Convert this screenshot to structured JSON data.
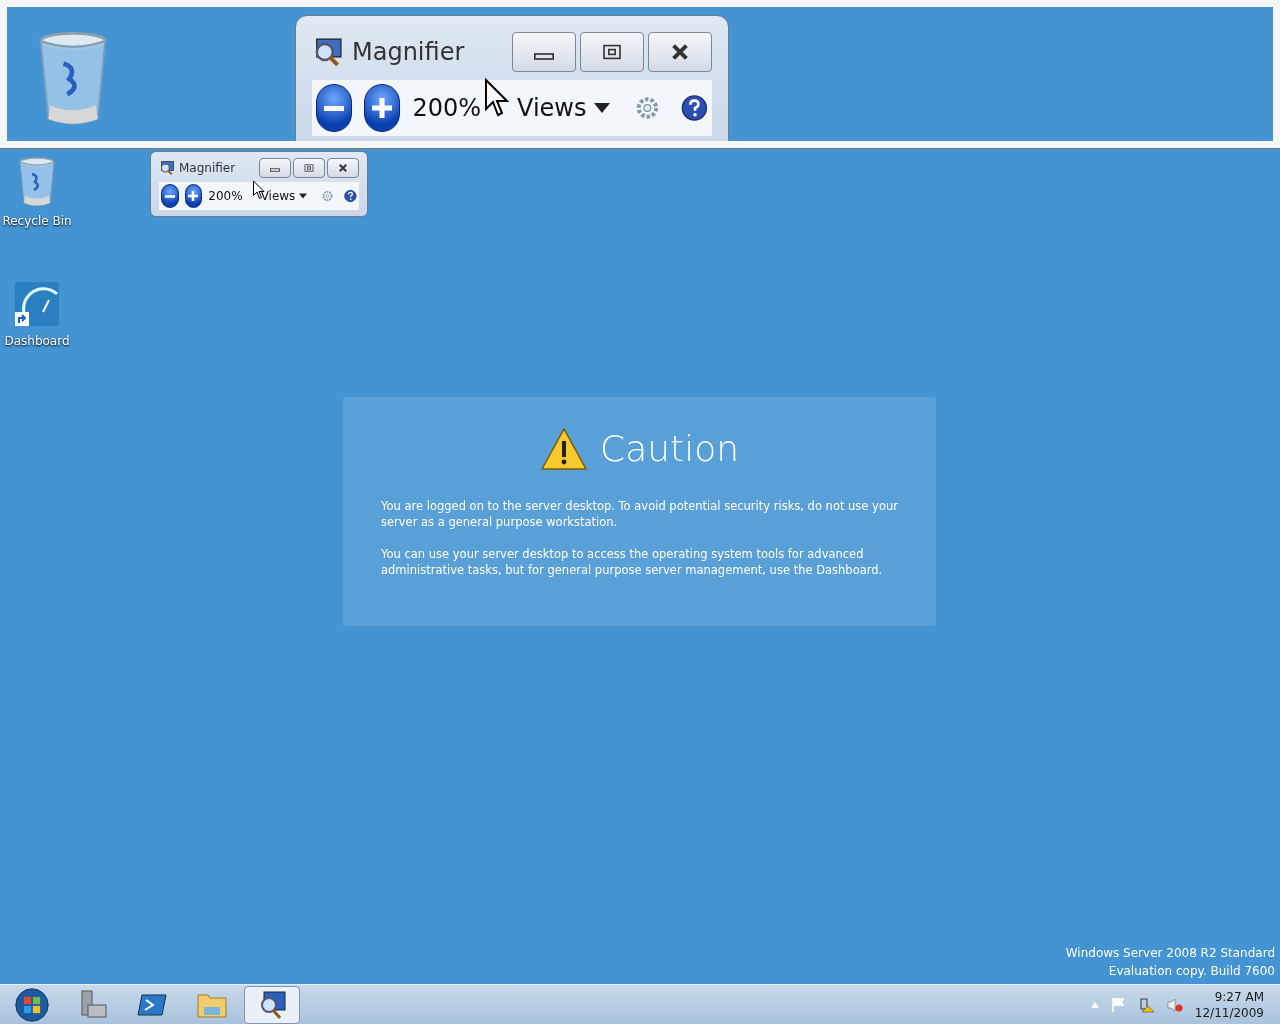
{
  "magnifier_view": {
    "title": "Magnifier",
    "zoom": "200%",
    "views_label": "Views"
  },
  "desktop_icons": [
    {
      "kind": "recycle",
      "label": "Recycle Bin"
    },
    {
      "kind": "dashboard",
      "label": "Dashboard"
    }
  ],
  "magnifier_window": {
    "title": "Magnifier",
    "zoom": "200%",
    "views_label": "Views"
  },
  "caution": {
    "title": "Caution",
    "paragraphs": [
      "You are logged on to the server desktop. To avoid potential security risks, do not use your server as a general purpose workstation.",
      "You can use your server desktop to access the operating system tools for advanced administrative tasks, but for general purpose server management, use the Dashboard."
    ]
  },
  "desktop_notice": [
    "Windows Server 2008 R2 Standard",
    "Evaluation copy. Build 7600"
  ],
  "taskbar": {
    "buttons": [
      {
        "kind": "start",
        "selected": false
      },
      {
        "kind": "server-manager",
        "selected": false
      },
      {
        "kind": "powershell",
        "selected": false
      },
      {
        "kind": "explorer",
        "selected": false
      },
      {
        "kind": "magnifier",
        "selected": true
      }
    ],
    "time": "9:27 AM",
    "date": "12/11/2009"
  }
}
